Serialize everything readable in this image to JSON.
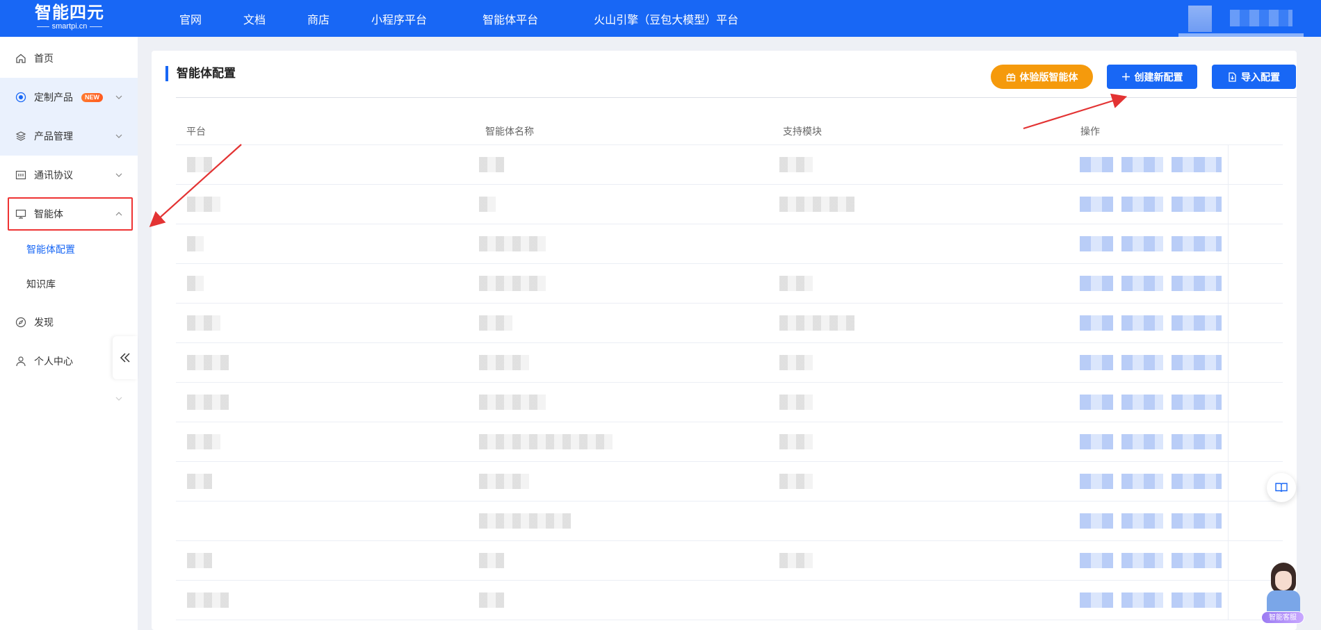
{
  "header": {
    "logo_text": "智能四元",
    "logo_sub": "smartpi.cn",
    "nav": [
      "官网",
      "文档",
      "商店",
      "小程序平台",
      "智能体平台",
      "火山引擎（豆包大模型）平台"
    ]
  },
  "sidebar": {
    "items": [
      {
        "label": "首页",
        "icon": "home-icon"
      },
      {
        "label": "定制产品",
        "icon": "target-icon",
        "badge": "NEW"
      },
      {
        "label": "产品管理",
        "icon": "layers-icon"
      },
      {
        "label": "通讯协议",
        "icon": "protocol-icon"
      },
      {
        "label": "智能体",
        "icon": "monitor-icon"
      },
      {
        "label": "发现",
        "icon": "compass-icon"
      },
      {
        "label": "个人中心",
        "icon": "user-icon"
      }
    ],
    "subitems": [
      {
        "label": "智能体配置",
        "active": true
      },
      {
        "label": "知识库",
        "active": false
      }
    ]
  },
  "main": {
    "title": "智能体配置",
    "buttons": {
      "trial": "体验版智能体",
      "create": "创建新配置",
      "import": "导入配置"
    },
    "table": {
      "columns": [
        "平台",
        "智能体名称",
        "支持模块",
        "操作"
      ],
      "row_count": 12
    }
  },
  "widgets": {
    "customer_service_label": "智能客服"
  },
  "colors": {
    "primary": "#1867f5",
    "trial_orange": "#f59a0c",
    "annotation_red": "#e33333"
  }
}
